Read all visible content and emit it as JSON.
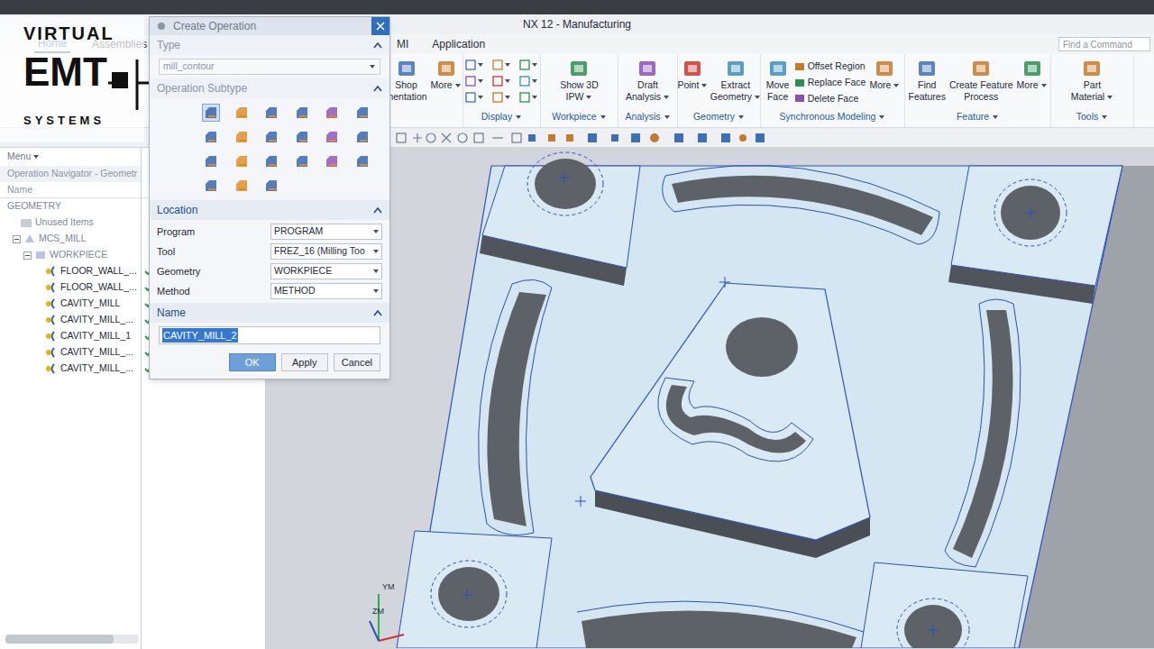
{
  "window": {
    "title": "NX 12 - Manufacturing"
  },
  "watermark": {
    "lines": [
      "VIRTUAL",
      "EMT",
      "SYSTEMS"
    ]
  },
  "quick_access": {
    "menu": "Menu"
  },
  "ribbon_tabs": [
    {
      "label": "Home",
      "selected": true
    },
    {
      "label": "Assemblies",
      "selected": false
    },
    {
      "label": "MI",
      "selected": false
    },
    {
      "label": "Application",
      "selected": false
    }
  ],
  "search": {
    "placeholder": "Find a Command"
  },
  "ribbon_groups": [
    {
      "kind": "buttons",
      "buttons": [
        {
          "kind": "large",
          "lines": [
            "Shop",
            "mentation"
          ],
          "dropdown": false
        },
        {
          "kind": "large",
          "lines": [
            "More"
          ],
          "dropdown": true
        }
      ]
    },
    {
      "label": "Display",
      "kind": "icons"
    },
    {
      "label": "Workpiece",
      "kind": "buttons",
      "buttons": [
        {
          "kind": "large",
          "lines": [
            "Show 3D",
            "IPW"
          ],
          "dropdown": true
        }
      ]
    },
    {
      "label": "Analysis",
      "kind": "buttons",
      "buttons": [
        {
          "kind": "large",
          "lines": [
            "Draft",
            "Analysis"
          ],
          "dropdown": true
        }
      ]
    },
    {
      "label": "Geometry",
      "kind": "buttons",
      "buttons": [
        {
          "kind": "large",
          "lines": [
            "Point"
          ],
          "dropdown": true
        },
        {
          "kind": "large",
          "lines": [
            "Extract",
            "Geometry"
          ],
          "dropdown": true
        }
      ]
    },
    {
      "label": "Synchronous Modeling",
      "kind": "buttons",
      "buttons": [
        {
          "kind": "large",
          "lines": [
            "Move",
            "Face"
          ],
          "dropdown": false
        },
        {
          "kind": "list",
          "items": [
            "Offset Region",
            "Replace Face",
            "Delete Face"
          ]
        },
        {
          "kind": "large",
          "lines": [
            "More"
          ],
          "dropdown": true
        }
      ]
    },
    {
      "label": "Feature",
      "kind": "buttons",
      "buttons": [
        {
          "kind": "large",
          "lines": [
            "Find",
            "Features"
          ],
          "dropdown": false
        },
        {
          "kind": "large",
          "lines": [
            "Create Feature",
            "Process"
          ],
          "dropdown": false
        },
        {
          "kind": "large",
          "lines": [
            "More"
          ],
          "dropdown": true
        }
      ]
    },
    {
      "label": "Tools",
      "kind": "buttons",
      "buttons": [
        {
          "kind": "large",
          "lines": [
            "Part",
            "Material"
          ],
          "dropdown": true
        }
      ]
    }
  ],
  "navigator": {
    "title": "Operation Navigator - Geometr",
    "column": "Name",
    "items": [
      {
        "label": "GEOMETRY",
        "kind": "root",
        "done": false
      },
      {
        "label": "Unused Items",
        "kind": "folder",
        "done": false
      },
      {
        "label": "MCS_MILL",
        "kind": "mcs",
        "expanded": true,
        "done": false
      },
      {
        "label": "WORKPIECE",
        "kind": "workpiece",
        "expanded": true,
        "done": false
      },
      {
        "label": "FLOOR_WALL_...",
        "kind": "operation",
        "done": true
      },
      {
        "label": "FLOOR_WALL_...",
        "kind": "operation",
        "done": true
      },
      {
        "label": "CAVITY_MILL",
        "kind": "operation",
        "done": true
      },
      {
        "label": "CAVITY_MILL_...",
        "kind": "operation",
        "done": true
      },
      {
        "label": "CAVITY_MILL_1",
        "kind": "operation",
        "done": true
      },
      {
        "label": "CAVITY_MILL_...",
        "kind": "operation",
        "done": true
      },
      {
        "label": "CAVITY_MILL_...",
        "kind": "operation",
        "done": true
      }
    ]
  },
  "dialog": {
    "title": "Create Operation",
    "type": {
      "header": "Type",
      "expanded": true,
      "value": "mill_contour"
    },
    "subtype": {
      "header": "Operation Subtype",
      "expanded": true,
      "icons": [
        {
          "selected": true
        },
        {
          "selected": false
        },
        {
          "selected": false
        },
        {
          "selected": false
        },
        {
          "selected": false
        },
        {
          "selected": false
        },
        {
          "selected": false
        },
        {
          "selected": false
        },
        {
          "selected": false
        },
        {
          "selected": false
        },
        {
          "selected": false
        },
        {
          "selected": false
        },
        {
          "selected": false
        },
        {
          "selected": false
        },
        {
          "selected": false
        },
        {
          "selected": false
        },
        {
          "selected": false
        },
        {
          "selected": false
        },
        {
          "selected": false
        },
        {
          "selected": false
        },
        {
          "selected": false
        }
      ]
    },
    "location": {
      "header": "Location",
      "expanded": true,
      "fields": [
        {
          "label": "Program",
          "value": "PROGRAM"
        },
        {
          "label": "Tool",
          "value": "FREZ_16 (Milling Too"
        },
        {
          "label": "Geometry",
          "value": "WORKPIECE"
        },
        {
          "label": "Method",
          "value": "METHOD"
        }
      ]
    },
    "name": {
      "header": "Name",
      "expanded": true,
      "value": "CAVITY_MILL_2",
      "selected": true
    },
    "buttons": [
      {
        "label": "OK",
        "default": true
      },
      {
        "label": "Apply",
        "default": false
      },
      {
        "label": "Cancel",
        "default": false
      }
    ]
  },
  "viewport": {
    "axes": [
      "YM",
      "ZM"
    ]
  }
}
